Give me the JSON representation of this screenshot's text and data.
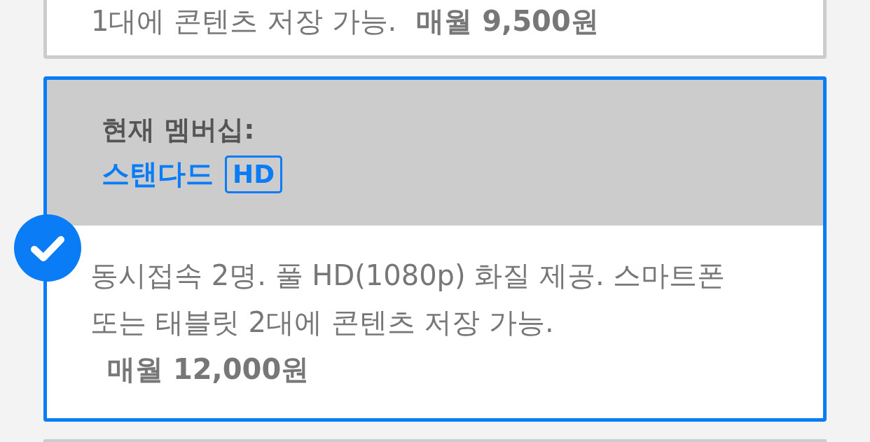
{
  "plans": [
    {
      "kind": "plan",
      "selected": false,
      "description": "1대에 콘텐츠 저장 가능.",
      "price": "매월 9,500원"
    },
    {
      "kind": "current",
      "selected": true,
      "current_label": "현재 멤버십:",
      "name": "스탠다드",
      "badge": "HD",
      "description": "동시접속 2명. 풀 HD(1080p) 화질 제공. 스마트폰 또는 태블릿 2대에 콘텐츠 저장 가능.",
      "price": "매월 12,000원"
    },
    {
      "kind": "plan",
      "selected": false
    }
  ]
}
